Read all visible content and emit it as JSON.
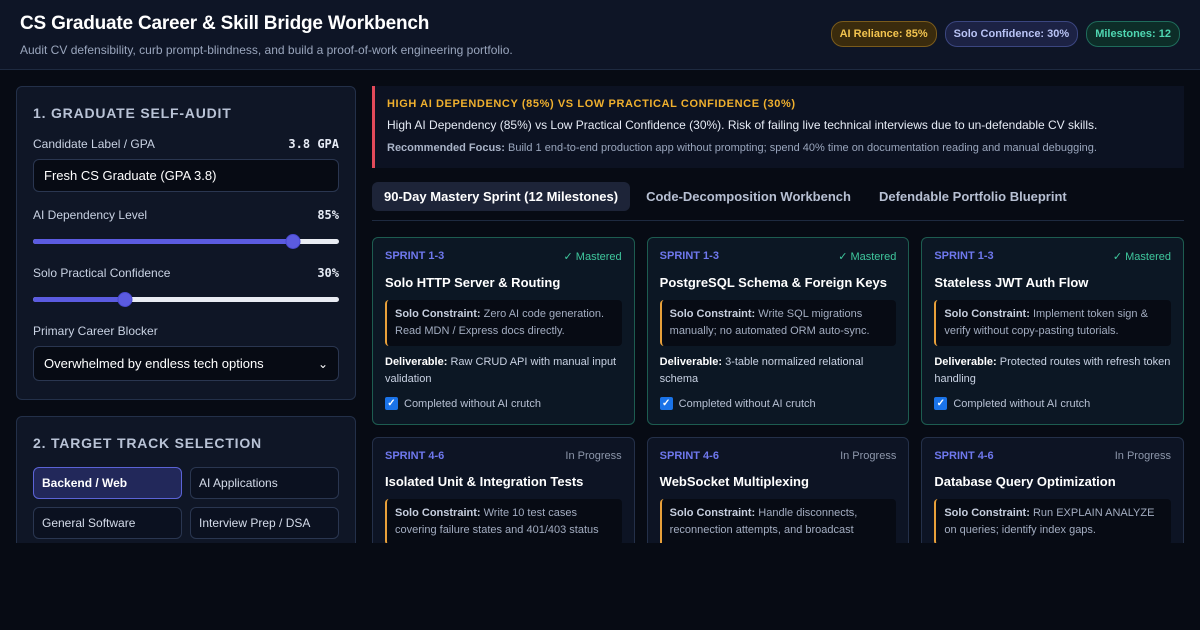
{
  "header": {
    "title": "CS Graduate Career & Skill Bridge Workbench",
    "subtitle": "Audit CV defensibility, curb prompt-blindness, and build a proof-of-work engineering portfolio.",
    "badges": {
      "ai": "AI Reliance: 85%",
      "solo": "Solo Confidence: 30%",
      "milestones": "Milestones: 12"
    }
  },
  "audit": {
    "title": "1. Graduate Self-Audit",
    "candidate_label": "Candidate Label / GPA",
    "gpa_value": "3.8 GPA",
    "candidate_input": "Fresh CS Graduate (GPA 3.8)",
    "ai_label": "AI Dependency Level",
    "ai_value": "85%",
    "ai_level": 0.85,
    "solo_label": "Solo Practical Confidence",
    "solo_value": "30%",
    "solo_level": 0.3,
    "blocker_label": "Primary Career Blocker",
    "blocker_value": "Overwhelmed by endless tech options"
  },
  "tracks": {
    "title": "2. Target Track Selection",
    "items": [
      {
        "label": "Backend / Web",
        "active": true
      },
      {
        "label": "AI Applications",
        "active": false
      },
      {
        "label": "General Software",
        "active": false
      },
      {
        "label": "Interview Prep / DSA",
        "active": false
      }
    ]
  },
  "alert": {
    "heading": "High AI Dependency (85%) vs Low Practical Confidence (30%)",
    "body": "High AI Dependency (85%) vs Low Practical Confidence (30%). Risk of failing live technical interviews due to un-defendable CV skills.",
    "rec_label": "Recommended Focus:",
    "rec_text": "Build 1 end-to-end production app without prompting; spend 40% time on documentation reading and manual debugging."
  },
  "tabs": [
    "90-Day Mastery Sprint (12 Milestones)",
    "Code-Decomposition Workbench",
    "Defendable Portfolio Blueprint"
  ],
  "labels": {
    "constraint": "Solo Constraint:",
    "deliverable": "Deliverable:",
    "check": "Completed without AI crutch"
  },
  "cards": [
    {
      "sprint": "SPRINT 1-3",
      "status": "✓ Mastered",
      "title": "Solo HTTP Server & Routing",
      "constraint": "Zero AI code generation. Read MDN / Express docs directly.",
      "deliverable": "Raw CRUD API with manual input validation"
    },
    {
      "sprint": "SPRINT 1-3",
      "status": "✓ Mastered",
      "title": "PostgreSQL Schema & Foreign Keys",
      "constraint": "Write SQL migrations manually; no automated ORM auto-sync.",
      "deliverable": "3-table normalized relational schema"
    },
    {
      "sprint": "SPRINT 1-3",
      "status": "✓ Mastered",
      "title": "Stateless JWT Auth Flow",
      "constraint": "Implement token sign & verify without copy-pasting tutorials.",
      "deliverable": "Protected routes with refresh token handling"
    },
    {
      "sprint": "SPRINT 4-6",
      "status": "In Progress",
      "title": "Isolated Unit & Integration Tests",
      "constraint": "Write 10 test cases covering failure states and 401/403 status",
      "deliverable": ""
    },
    {
      "sprint": "SPRINT 4-6",
      "status": "In Progress",
      "title": "WebSocket Multiplexing",
      "constraint": "Handle disconnects, reconnection attempts, and broadcast rooms.",
      "deliverable": ""
    },
    {
      "sprint": "SPRINT 4-6",
      "status": "In Progress",
      "title": "Database Query Optimization",
      "constraint": "Run EXPLAIN ANALYZE on queries; identify index gaps.",
      "deliverable": ""
    }
  ]
}
